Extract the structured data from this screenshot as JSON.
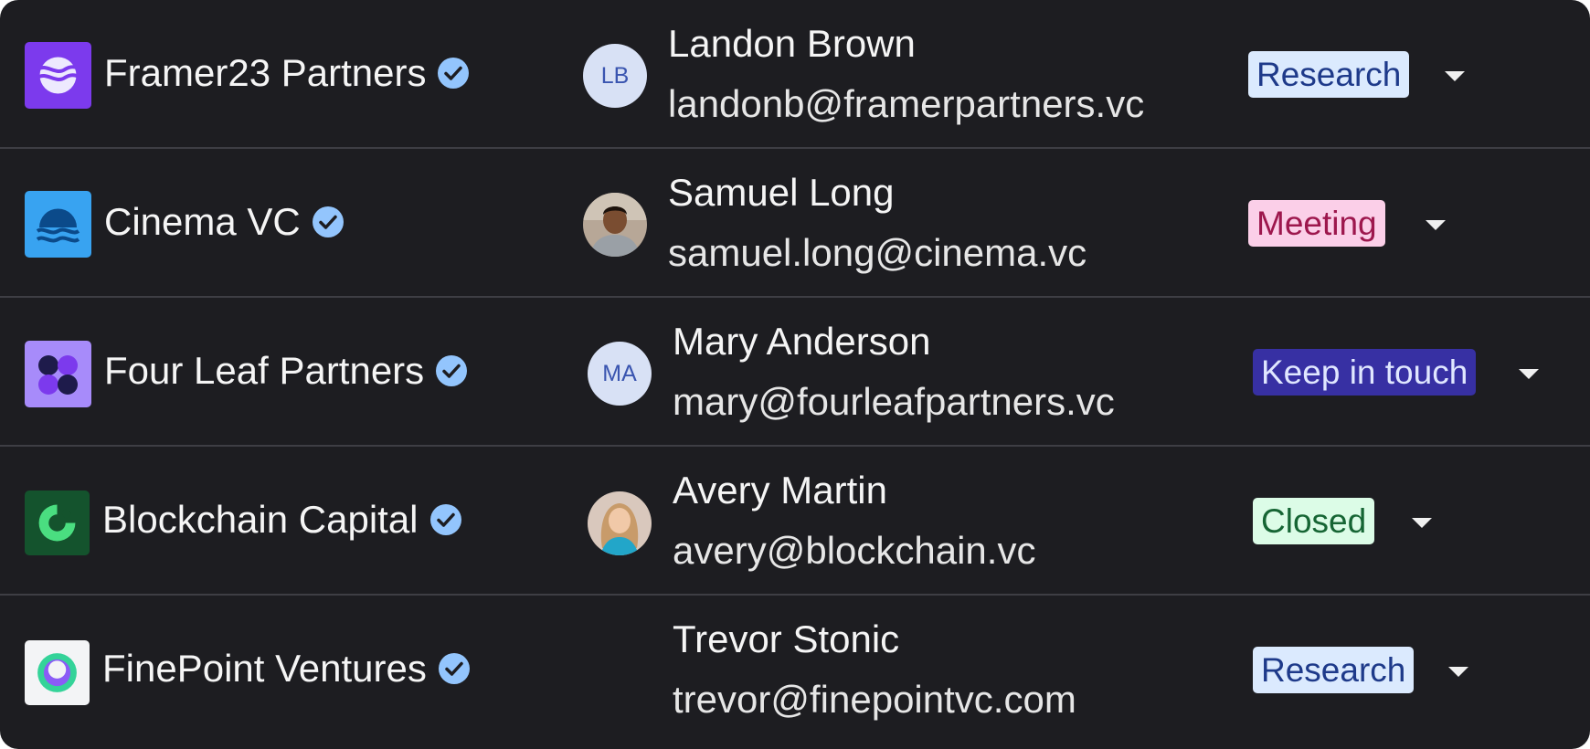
{
  "rows": [
    {
      "company": "Framer23 Partners",
      "logo": "framer23-partners-logo",
      "contact_name": "Landon Brown",
      "contact_email": "landonb@framerpartners.vc",
      "avatar_initials": "LB",
      "status": "Research",
      "status_colors": {
        "bg": "#dbeafe",
        "fg": "#1e3a8a"
      }
    },
    {
      "company": "Cinema VC",
      "logo": "cinema-vc-logo",
      "contact_name": "Samuel Long",
      "contact_email": "samuel.long@cinema.vc",
      "avatar_photo": "samuel-long-photo",
      "status": "Meeting",
      "status_colors": {
        "bg": "#fbcfe8",
        "fg": "#9d174d"
      }
    },
    {
      "company": "Four Leaf Partners",
      "logo": "four-leaf-partners-logo",
      "contact_name": "Mary Anderson",
      "contact_email": "mary@fourleafpartners.vc",
      "avatar_initials": "MA",
      "status": "Keep in touch",
      "status_colors": {
        "bg": "#3730a3",
        "fg": "#e0e7ff"
      }
    },
    {
      "company": "Blockchain Capital",
      "logo": "blockchain-capital-logo",
      "contact_name": "Avery Martin",
      "contact_email": "avery@blockchain.vc",
      "avatar_photo": "avery-martin-photo",
      "status": "Closed",
      "status_colors": {
        "bg": "#dcfce7",
        "fg": "#166534"
      }
    },
    {
      "company": "FinePoint Ventures",
      "logo": "finepoint-ventures-logo",
      "contact_name": "Trevor Stonic",
      "contact_email": "trevor@finepointvc.com",
      "status": "Research",
      "status_colors": {
        "bg": "#dbeafe",
        "fg": "#1e3a8a"
      }
    }
  ],
  "icons": {
    "verified": "verified-check-icon",
    "status_dropdown": "chevron-down-icon"
  },
  "colors": {
    "panel_bg": "#1d1d21",
    "divider": "#3e3e44",
    "verified_badge": "#93c5fd"
  }
}
